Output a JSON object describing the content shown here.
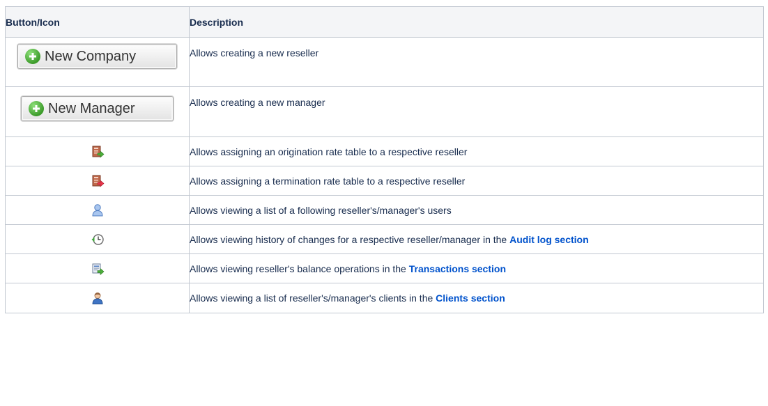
{
  "table": {
    "headers": [
      "Button/Icon",
      "Description"
    ],
    "rows": [
      {
        "icon": "new-company-button",
        "button_label": "New Company",
        "text": "Allows creating a new reseller"
      },
      {
        "icon": "new-manager-button",
        "button_label": "New Manager",
        "text": "Allows creating a new manager"
      },
      {
        "icon": "origination-rate-table-icon",
        "text": "Allows assigning an origination rate table to a respective reseller"
      },
      {
        "icon": "termination-rate-table-icon",
        "text": "Allows assigning a termination rate table to a respective reseller"
      },
      {
        "icon": "users-icon",
        "text": "Allows viewing a list of a following reseller's/manager's users"
      },
      {
        "icon": "history-icon",
        "text": "Allows viewing history of changes for a respective reseller/manager in the ",
        "link": "Audit log section"
      },
      {
        "icon": "transactions-icon",
        "text": "Allows viewing reseller's balance operations in the ",
        "link": "Transactions section"
      },
      {
        "icon": "clients-icon",
        "text": "Allows viewing a list of reseller's/manager's clients in the ",
        "link": "Clients section"
      }
    ]
  },
  "colors": {
    "link": "#0052cc",
    "header_bg": "#f4f5f7",
    "border": "#c1c7d0",
    "text": "#172b4d"
  }
}
